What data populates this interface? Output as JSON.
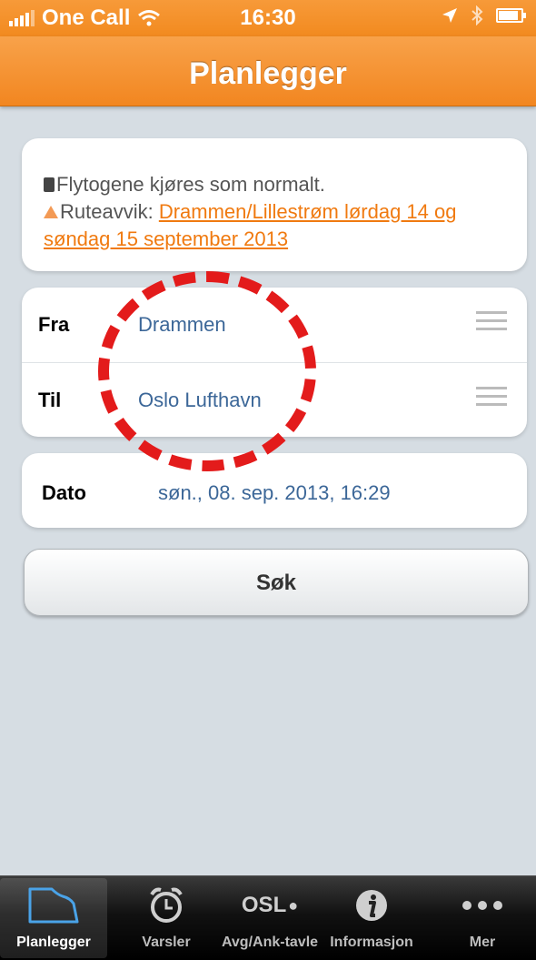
{
  "status_bar": {
    "carrier": "One Call",
    "time": "16:30",
    "battery_level": 0.95
  },
  "nav": {
    "title": "Planlegger"
  },
  "notice": {
    "line1": "Flytogene kjøres som normalt.",
    "deviation_label": "Ruteavvik: ",
    "deviation_link": "Drammen/Lillestrøm lørdag 14 og søndag 15 september 2013"
  },
  "route": {
    "from_label": "Fra",
    "from_value": "Drammen",
    "to_label": "Til",
    "to_value": "Oslo Lufthavn"
  },
  "date": {
    "label": "Dato",
    "value": "søn., 08. sep. 2013, 16:29"
  },
  "search": {
    "label": "Søk"
  },
  "tabs": [
    {
      "label": "Planlegger",
      "icon": "planner-icon",
      "active": true
    },
    {
      "label": "Varsler",
      "icon": "alarm-clock-icon",
      "active": false
    },
    {
      "label": "Avg/Ank-tavle",
      "icon": "osl-logo-icon",
      "icon_text": "OSL",
      "active": false
    },
    {
      "label": "Informasjon",
      "icon": "info-icon",
      "active": false
    },
    {
      "label": "Mer",
      "icon": "more-dots-icon",
      "active": false
    }
  ],
  "colors": {
    "accent_orange": "#f28620",
    "link_orange": "#f07a10",
    "value_blue": "#3c6798",
    "annotation_red": "#e31b1b"
  }
}
